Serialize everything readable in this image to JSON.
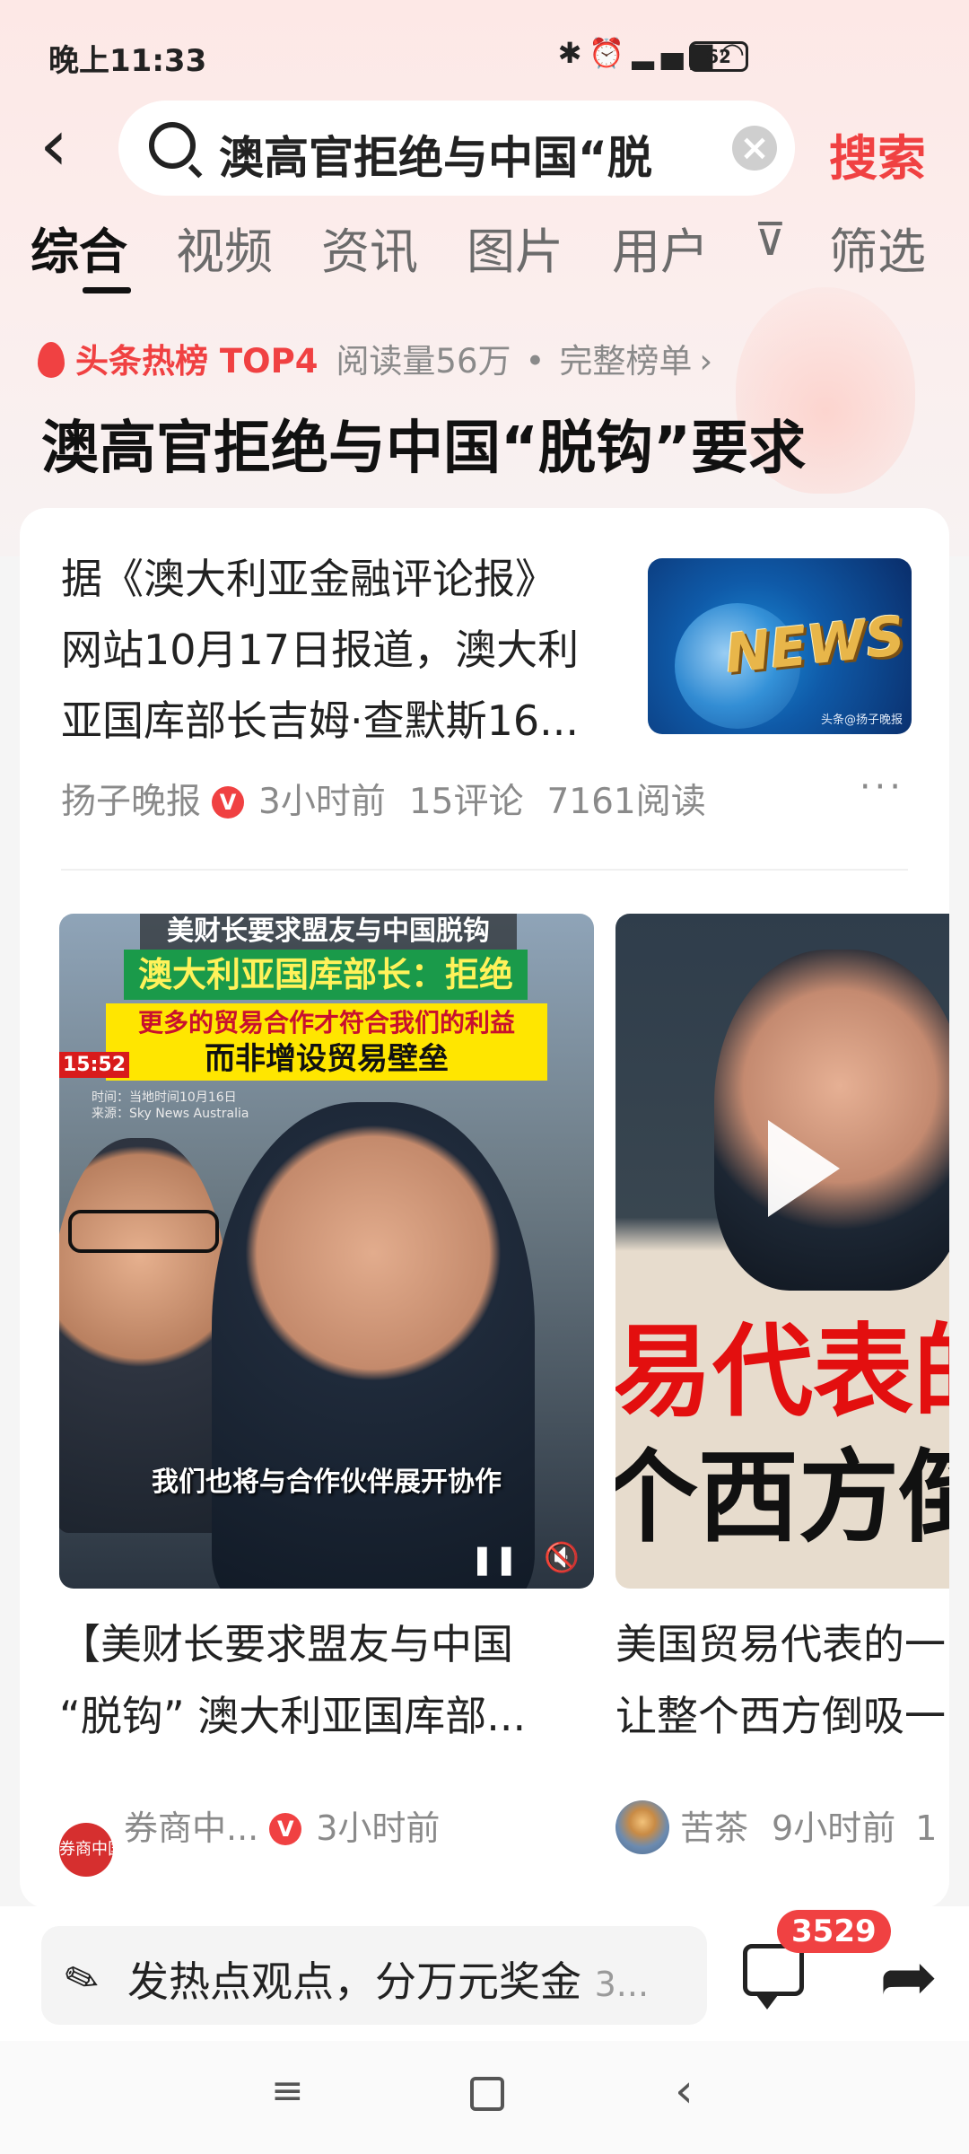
{
  "status_bar": {
    "time": "晚上11:33",
    "battery": "62"
  },
  "search": {
    "query": "澳高官拒绝与中国“脱",
    "submit_label": "搜索"
  },
  "tabs": [
    "综合",
    "视频",
    "资讯",
    "图片",
    "用户",
    "筛选"
  ],
  "hot_rank": {
    "tag": "头条热榜 TOP4",
    "reads": "阅读量56万",
    "separator": "•",
    "full_list": "完整榜单",
    "chevron": "›",
    "headline": "澳高官拒绝与中国“脱钩”要求"
  },
  "article": {
    "lines": [
      "据《澳大利亚金融评论报》",
      "网站10月17日报道，澳大利",
      "亚国库部长吉姆·查默斯16..."
    ],
    "thumbnail_text": "NEWS",
    "thumbnail_watermark": "头条@扬子晚报",
    "source": "扬子晚报",
    "verified": "V",
    "time": "3小时前",
    "comments": "15评论",
    "reads": "7161阅读",
    "more": "···"
  },
  "video1": {
    "banner_top": "美财长要求盟友与中国脱钩",
    "banner_green": "澳大利亚国库部长：拒绝",
    "banner_yellow_1": "更多的贸易合作才符合我们的利益",
    "banner_yellow_2": "而非增设贸易壁垒",
    "timecode": "15:52",
    "source_line_1": "时间：当地时间10月16日",
    "source_line_2": "来源：Sky News Australia",
    "caption": "我们也将与合作伙伴展开协作",
    "title_lines": [
      "【美财长要求盟友与中国",
      "“脱钩” 澳大利亚国库部..."
    ],
    "author": "券商中...",
    "avatar_text": "券商中国",
    "verified": "V",
    "time": "3小时前"
  },
  "video2": {
    "overlay_1": "易代表的",
    "overlay_2": "个西方倒",
    "title_lines": [
      "美国贸易代表的一",
      "让整个西方倒吸一"
    ],
    "author": "苦茶",
    "time": "9小时前",
    "extra": "1"
  },
  "bottom": {
    "placeholder": "发热点观点，分万元奖金",
    "placeholder_tail": "3...",
    "comment_count": "3529"
  },
  "colors": {
    "accent": "#f04142",
    "text": "#222222",
    "muted": "#8a8a8a"
  },
  "icons": [
    "back-arrow-icon",
    "search-icon",
    "clear-icon",
    "filter-icon",
    "fire-icon",
    "more-icon",
    "pause-icon",
    "mute-icon",
    "play-icon",
    "pen-icon",
    "comment-icon",
    "share-icon",
    "nav-menu-icon",
    "nav-home-icon",
    "nav-back-icon"
  ]
}
